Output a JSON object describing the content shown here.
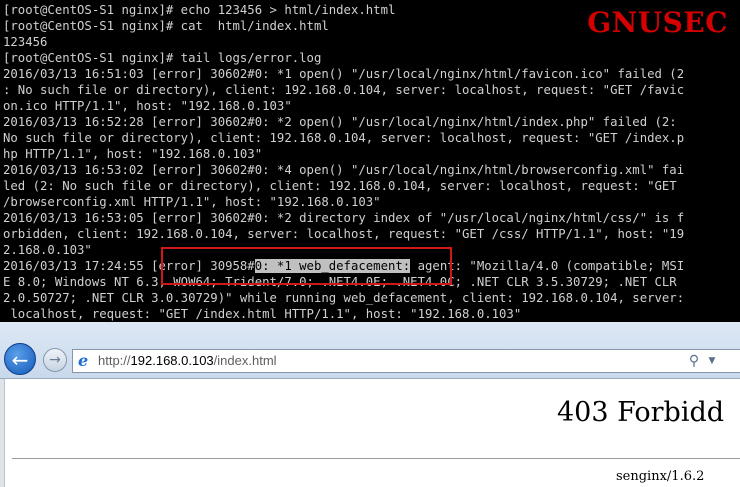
{
  "watermark": {
    "text": "GNUSEC",
    "color": "#d40000"
  },
  "terminal": {
    "lines": [
      "[root@CentOS-S1 nginx]# echo 123456 > html/index.html",
      "[root@CentOS-S1 nginx]# cat  html/index.html",
      "123456",
      "[root@CentOS-S1 nginx]# tail logs/error.log",
      "2016/03/13 16:51:03 [error] 30602#0: *1 open() \"/usr/local/nginx/html/favicon.ico\" failed (2",
      ": No such file or directory), client: 192.168.0.104, server: localhost, request: \"GET /favic",
      "on.ico HTTP/1.1\", host: \"192.168.0.103\"",
      "2016/03/13 16:52:28 [error] 30602#0: *2 open() \"/usr/local/nginx/html/index.php\" failed (2:",
      "No such file or directory), client: 192.168.0.104, server: localhost, request: \"GET /index.p",
      "hp HTTP/1.1\", host: \"192.168.0.103\"",
      "2016/03/13 16:53:02 [error] 30602#0: *4 open() \"/usr/local/nginx/html/browserconfig.xml\" fai",
      "led (2: No such file or directory), client: 192.168.0.104, server: localhost, request: \"GET",
      "/browserconfig.xml HTTP/1.1\", host: \"192.168.0.103\"",
      "2016/03/13 16:53:05 [error] 30602#0: *2 directory index of \"/usr/local/nginx/html/css/\" is f",
      "orbidden, client: 192.168.0.104, server: localhost, request: \"GET /css/ HTTP/1.1\", host: \"19",
      "2.168.0.103\""
    ],
    "highlighted_entry": {
      "before": "2016/03/13 17:24:55 [error] 30958#",
      "selected": "0: *1 web_defacement:",
      "after": " agent: \"Mozilla/4.0 (compatible; MSI"
    },
    "trailing_lines": [
      "E 8.0; Windows NT 6.3; WOW64; Trident/7.0; .NET4.0E; .NET4.0C; .NET CLR 3.5.30729; .NET CLR",
      "2.0.50727; .NET CLR 3.0.30729)\" while running web_defacement, client: 192.168.0.104, server:",
      " localhost, request: \"GET /index.html HTTP/1.1\", host: \"192.168.0.103\""
    ],
    "highlight_box_color": "#d01818"
  },
  "browser": {
    "back_icon": "back-arrow-icon",
    "forward_icon": "forward-arrow-icon",
    "address": {
      "scheme": "http://",
      "host": "192.168.0.103",
      "path": "/index.html"
    },
    "search_icon": "magnifier-icon",
    "dropdown_icon": "chevron-down-icon",
    "page_title": "403 Forbidd",
    "server_signature": "senginx/1.6.2"
  }
}
